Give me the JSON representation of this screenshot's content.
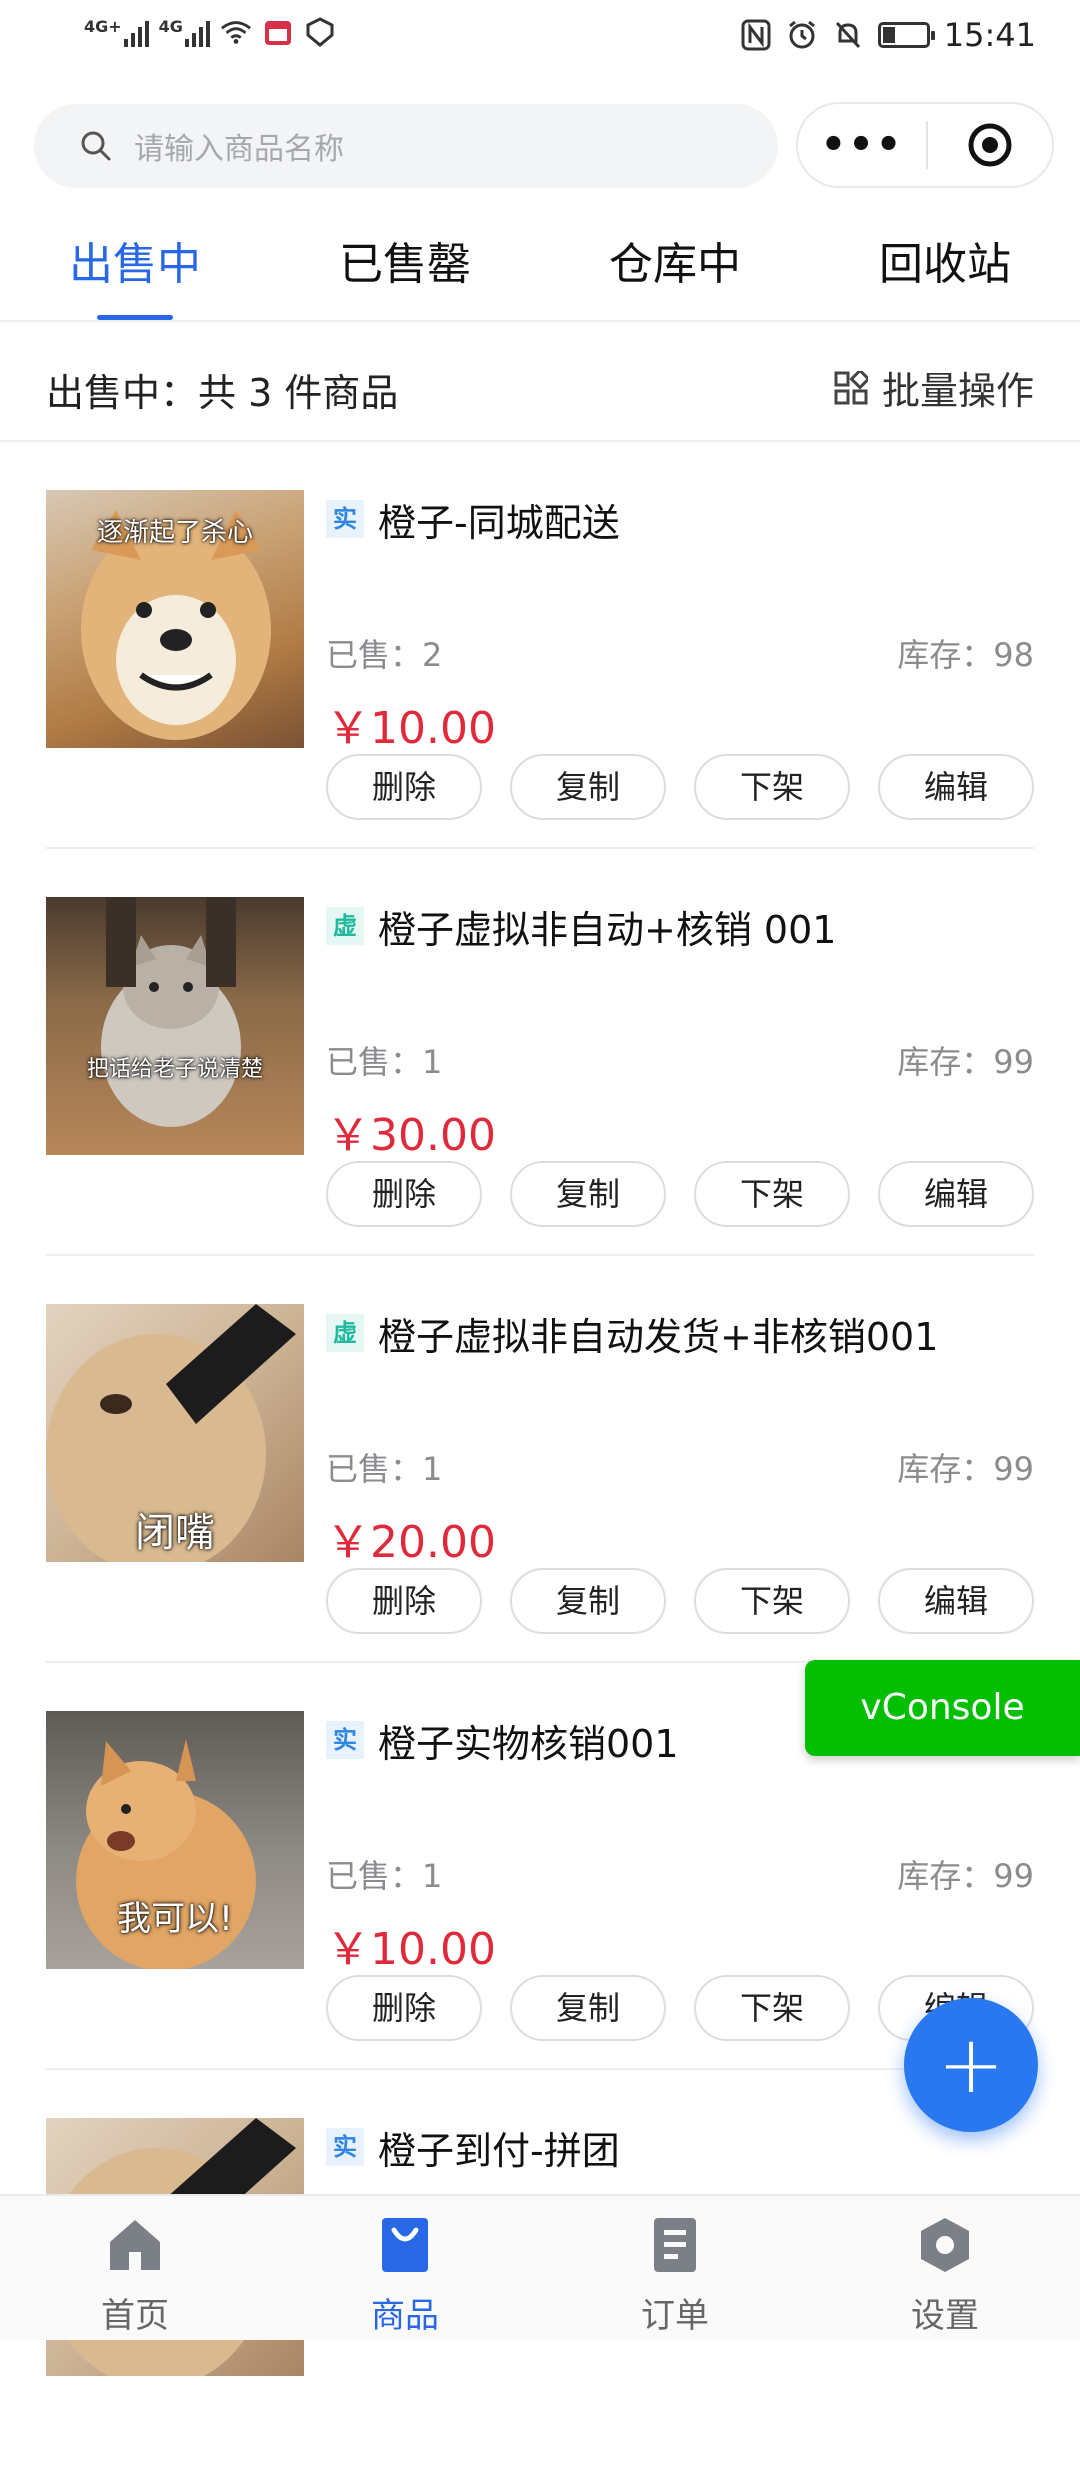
{
  "status_bar": {
    "network_1": "4G+",
    "network_2": "4G",
    "time": "15:41",
    "battery_level": 0.3
  },
  "search": {
    "placeholder": "请输入商品名称"
  },
  "capsule": {
    "more_label": "•••"
  },
  "tabs": [
    {
      "label": "出售中",
      "active": true
    },
    {
      "label": "已售罄",
      "active": false
    },
    {
      "label": "仓库中",
      "active": false
    },
    {
      "label": "回收站",
      "active": false
    }
  ],
  "count_bar": {
    "summary": "出售中：共 3 件商品",
    "batch_label": "批量操作"
  },
  "products": [
    {
      "tag": "实",
      "title": "橙子-同城配送",
      "sold": "已售：2",
      "stock": "库存：98",
      "price": "￥10.00",
      "image_caption": "逐渐起了杀心"
    },
    {
      "tag": "虚",
      "title": "橙子虚拟非自动+核销 001",
      "sold": "已售：1",
      "stock": "库存：99",
      "price": "￥30.00",
      "image_caption": "把话给老子说清楚"
    },
    {
      "tag": "虚",
      "title": "橙子虚拟非自动发货+非核销001",
      "sold": "已售：1",
      "stock": "库存：99",
      "price": "￥20.00",
      "image_caption": "闭嘴"
    },
    {
      "tag": "实",
      "title": "橙子实物核销001",
      "sold": "已售：1",
      "stock": "库存：99",
      "price": "￥10.00",
      "image_caption": "我可以!"
    },
    {
      "tag": "实",
      "title": "橙子到付-拼团",
      "sold": "",
      "stock": "",
      "price": "",
      "image_caption": ""
    }
  ],
  "actions": {
    "delete": "删除",
    "copy": "复制",
    "off_shelf": "下架",
    "edit": "编辑"
  },
  "vconsole": {
    "label": "vConsole"
  },
  "fab": {
    "symbol": "+"
  },
  "bottom_nav": [
    {
      "label": "首页",
      "icon": "home-icon",
      "active": false
    },
    {
      "label": "商品",
      "icon": "bag-icon",
      "active": true
    },
    {
      "label": "订单",
      "icon": "order-icon",
      "active": false
    },
    {
      "label": "设置",
      "icon": "settings-icon",
      "active": false
    }
  ],
  "colors": {
    "accent": "#2868e6",
    "price": "#e02a3c",
    "vconsole": "#04be02",
    "fab": "#2a78f0"
  }
}
